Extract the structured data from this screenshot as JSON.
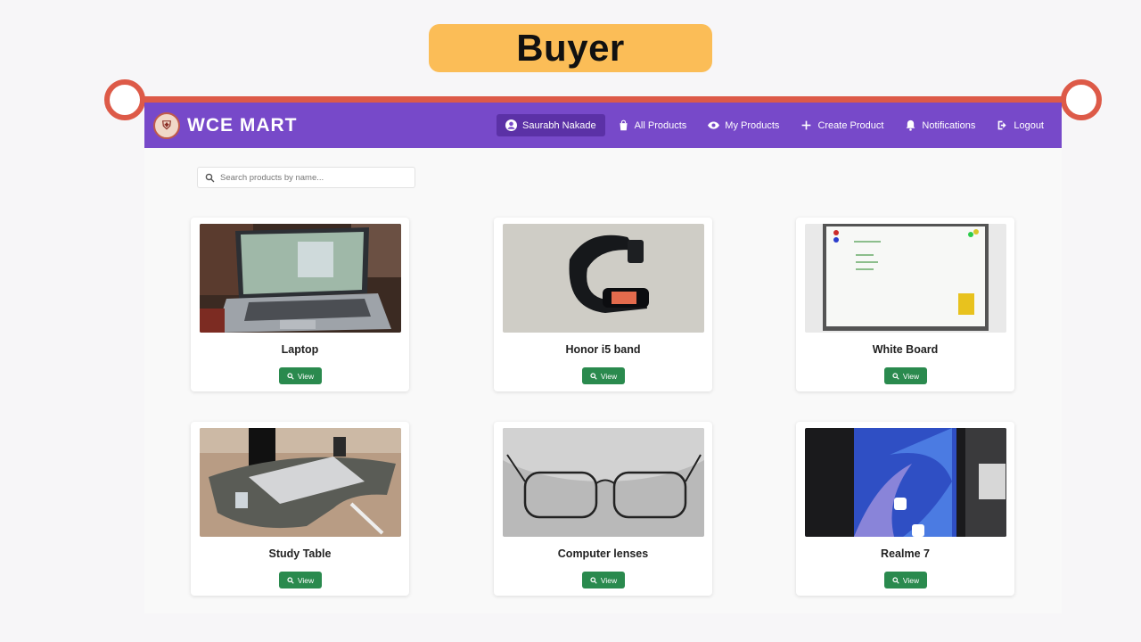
{
  "banner": {
    "title": "Buyer"
  },
  "navbar": {
    "brand": "WCE  MART",
    "items": [
      {
        "label": "Saurabh Nakade",
        "icon": "user-circle-icon",
        "active": true
      },
      {
        "label": "All Products",
        "icon": "shopping-bag-icon"
      },
      {
        "label": "My Products",
        "icon": "eye-icon"
      },
      {
        "label": "Create Product",
        "icon": "plus-icon"
      },
      {
        "label": "Notifications",
        "icon": "bell-icon"
      },
      {
        "label": "Logout",
        "icon": "logout-icon"
      }
    ]
  },
  "search": {
    "placeholder": "Search products by name..."
  },
  "products": [
    {
      "name": "Laptop",
      "button": "View"
    },
    {
      "name": "Honor i5 band",
      "button": "View"
    },
    {
      "name": "White Board",
      "button": "View"
    },
    {
      "name": "Study Table",
      "button": "View"
    },
    {
      "name": "Computer lenses",
      "button": "View"
    },
    {
      "name": "Realme 7",
      "button": "View"
    }
  ],
  "colors": {
    "navbar": "#7749c9",
    "accent_line": "#dd5a48",
    "banner": "#fbbd57",
    "view_button": "#2a8a4e"
  }
}
